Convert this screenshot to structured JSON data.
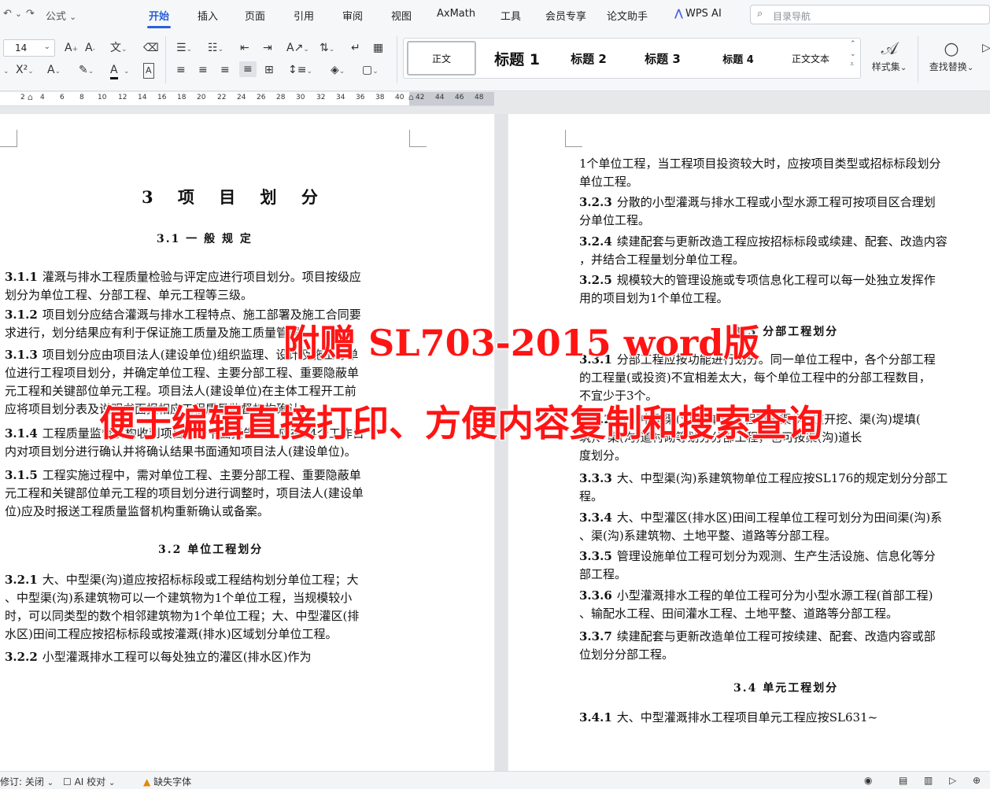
{
  "quick_access": {
    "formula_label": "公式"
  },
  "tabs": [
    "开始",
    "插入",
    "页面",
    "引用",
    "审阅",
    "视图",
    "AxMath",
    "工具",
    "会员专享",
    "论文助手",
    "WPS AI"
  ],
  "search": {
    "placeholder": "目录导航"
  },
  "toolbar": {
    "font_size": "14",
    "styles": [
      "正文",
      "标题 1",
      "标题 2",
      "标题 3",
      "标题 4",
      "正文文本"
    ],
    "style_set_label": "样式集",
    "find_replace_label": "查找替换"
  },
  "ruler": {
    "ticks": [
      "2",
      "4",
      "6",
      "8",
      "10",
      "12",
      "14",
      "16",
      "18",
      "20",
      "22",
      "24",
      "26",
      "28",
      "30",
      "32",
      "34",
      "36",
      "38",
      "40",
      "42",
      "44",
      "46",
      "48"
    ]
  },
  "left_page": {
    "chapter_title": "3 项 目 划 分",
    "sec31": "3.1 一 般 规 定",
    "paras": [
      {
        "num": "3.1.1",
        "lines": [
          "灌溉与排水工程质量检验与评定应进行项目划分。项目按级应",
          "划分为单位工程、分部工程、单元工程等三级。"
        ]
      },
      {
        "num": "3.1.2",
        "lines": [
          "项目划分应结合灌溉与排水工程特点、施工部署及施工合同要",
          "求进行，划分结果应有利于保证施工质量及施工质量管理。"
        ]
      },
      {
        "num": "3.1.3",
        "lines": [
          "项目划分应由项目法人(建设单位)组织监理、设计及施工等单",
          "位进行工程项目划分，并确定单位工程、主要分部工程、重要隐蔽单",
          "元工程和关键部位单元工程。项目法人(建设单位)在主体工程开工前",
          "应将项目划分表及说明书面报相应工程质量监督机构确认。"
        ]
      },
      {
        "num": "3.1.4",
        "lines": [
          "工程质量监督机构收到项目划分书面报告后，应在14个工作日",
          "内对项目划分进行确认并将确认结果书面通知项目法人(建设单位)。"
        ]
      },
      {
        "num": "3.1.5",
        "lines": [
          "工程实施过程中，需对单位工程、主要分部工程、重要隐蔽单",
          "元工程和关键部位单元工程的项目划分进行调整时，项目法人(建设单",
          "位)应及时报送工程质量监督机构重新确认或备案。"
        ]
      }
    ],
    "sec32": "3.2 单位工程划分",
    "paras2": [
      {
        "num": "3.2.1",
        "lines": [
          "大、中型渠(沟)道应按招标标段或工程结构划分单位工程；大",
          "、中型渠(沟)系建筑物可以一个建筑物为1个单位工程，当规模较小",
          "时，可以同类型的数个相邻建筑物为1个单位工程；大、中型灌区(排",
          "水区)田间工程应按招标标段或按灌溉(排水)区域划分单位工程。"
        ]
      },
      {
        "num": "3.2.2",
        "lines": [
          "小型灌溉排水工程可以每处独立的灌区(排水区)作为"
        ]
      }
    ]
  },
  "right_page": {
    "cont_lines": [
      "1个单位工程，当工程项目投资较大时，应按项目类型或招标标段划分",
      "单位工程。"
    ],
    "paras": [
      {
        "num": "3.2.3",
        "lines": [
          "分散的小型灌溉与排水工程或小型水源工程可按项目区合理划",
          "分单位工程。"
        ]
      },
      {
        "num": "3.2.4",
        "lines": [
          "续建配套与更新改造工程应按招标标段或续建、配套、改造内容",
          "，并结合工程量划分单位工程。"
        ]
      },
      {
        "num": "3.2.5",
        "lines": [
          "规模较大的管理设施或专项信息化工程可以每一处独立发挥作",
          "用的项目划为1个单位工程。"
        ]
      }
    ],
    "sec33": "3.3 分部工程划分",
    "paras2": [
      {
        "num": "3.3.1",
        "lines": [
          "分部工程应按功能进行划分。同一单位工程中，各个分部工程",
          "的工程量(或投资)不宜相差太大，每个单位工程中的分部工程数目，",
          "不宜少于3个。"
        ]
      },
      {
        "num": "3.3.2",
        "lines": [
          "大、中型渠(沟)道单位工程可按渠(沟)道开挖、渠(沟)堤填(",
          "筑)、渠(沟)道衬砌等划分分部工程，也可按渠(沟)道长",
          "度划分。"
        ]
      },
      {
        "num": "3.3.3",
        "lines": [
          "大、中型渠(沟)系建筑物单位工程应按SL176的规定划分分部工",
          "程。"
        ]
      },
      {
        "num": "3.3.4",
        "lines": [
          "大、中型灌区(排水区)田间工程单位工程可划分为田间渠(沟)系",
          "、渠(沟)系建筑物、土地平整、道路等分部工程。"
        ]
      },
      {
        "num": "3.3.5",
        "lines": [
          "管理设施单位工程可划分为观测、生产生活设施、信息化等分",
          "部工程。"
        ]
      },
      {
        "num": "3.3.6",
        "lines": [
          "小型灌溉排水工程的单位工程可分为小型水源工程(首部工程)",
          "、输配水工程、田间灌水工程、土地平整、道路等分部工程。"
        ]
      },
      {
        "num": "3.3.7",
        "lines": [
          "续建配套与更新改造单位工程可按续建、配套、改造内容或部",
          "位划分分部工程。"
        ]
      }
    ],
    "sec34": "3.4 单元工程划分",
    "para_last": {
      "num": "3.4.1",
      "lines": [
        "大、中型灌溉排水工程项目单元工程应按SL631~"
      ]
    }
  },
  "overlay": {
    "line1": "附赠 SL703-2015 word版",
    "line2": "便于编辑直接打印、方便内容复制和搜索查询"
  },
  "statusbar": {
    "revise": "修订: 关闭",
    "ai_check": "AI 校对",
    "missing_font": "缺失字体"
  }
}
